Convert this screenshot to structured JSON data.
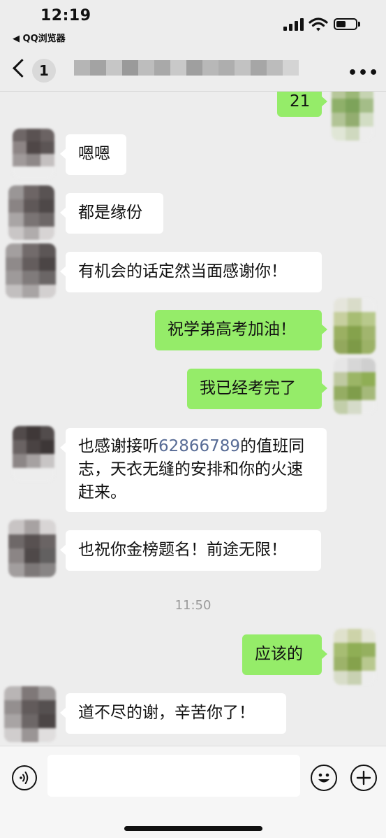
{
  "status_bar": {
    "time": "12:19",
    "back_app": "◀ QQ浏览器"
  },
  "nav": {
    "unread_count": "1",
    "more": "•••"
  },
  "timestamp": "11:50",
  "messages": [
    {
      "side": "out",
      "text": "21"
    },
    {
      "side": "in",
      "text": "嗯嗯"
    },
    {
      "side": "in",
      "text": "都是缘份"
    },
    {
      "side": "in",
      "text": "有机会的话定然当面感谢你！"
    },
    {
      "side": "out",
      "text": "祝学弟高考加油！"
    },
    {
      "side": "out",
      "text": "我已经考完了"
    },
    {
      "side": "in",
      "text_before": "也感谢接听",
      "phone": "62866789",
      "text_after": "的值班同志，天衣无缝的安排和你的火速赶来。"
    },
    {
      "side": "in",
      "text": "也祝你金榜题名！前途无限！"
    },
    {
      "side": "out",
      "text": "应该的"
    },
    {
      "side": "in",
      "text": "道不尽的谢，辛苦你了！"
    }
  ],
  "colors": {
    "background": "#ededed",
    "incoming_bubble": "#ffffff",
    "outgoing_bubble": "#95ec69",
    "link": "#576b95"
  },
  "input_bar": {
    "voice_icon": "voice-icon",
    "emoji_icon": "emoji-icon",
    "plus_icon": "plus-icon"
  }
}
